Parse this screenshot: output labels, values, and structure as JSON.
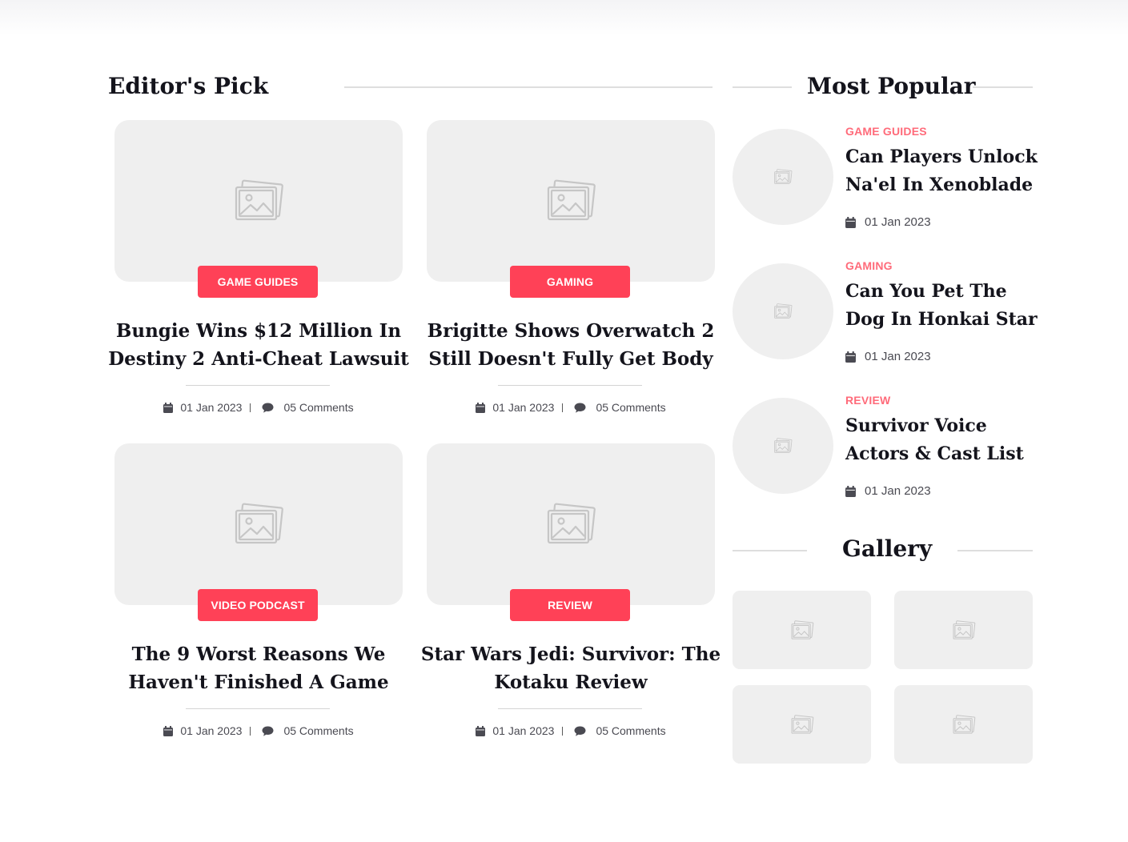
{
  "editors_pick": {
    "heading": "Editor's Pick",
    "cards": [
      {
        "category": "GAME GUIDES",
        "title": "Bungie Wins $12 Million In Destiny 2 Anti-Cheat Lawsuit",
        "date": "01 Jan 2023",
        "comments": "05 Comments"
      },
      {
        "category": "GAMING",
        "title": "Brigitte Shows Overwatch 2 Still Doesn't Fully Get Body",
        "date": "01 Jan 2023",
        "comments": "05 Comments"
      },
      {
        "category": "VIDEO PODCAST",
        "title": "The 9 Worst Reasons We Haven't Finished A Game",
        "date": "01 Jan 2023",
        "comments": "05 Comments"
      },
      {
        "category": "REVIEW",
        "title": "Star Wars Jedi: Survivor: The Kotaku Review",
        "date": "01 Jan 2023",
        "comments": "05 Comments"
      }
    ]
  },
  "most_popular": {
    "heading": "Most Popular",
    "items": [
      {
        "category": "GAME GUIDES",
        "title": "Can Players Unlock Na'el In Xenoblade",
        "date": "01 Jan 2023"
      },
      {
        "category": "GAMING",
        "title": "Can You Pet The Dog In Honkai Star",
        "date": "01 Jan 2023"
      },
      {
        "category": "REVIEW",
        "title": "Survivor Voice Actors & Cast List",
        "date": "01 Jan 2023"
      }
    ]
  },
  "gallery": {
    "heading": "Gallery"
  },
  "icons": {
    "placeholder": "image-placeholder-icon",
    "date": "calendar-icon",
    "comments": "comment-icon"
  },
  "colors": {
    "accent": "#ff4157",
    "category_text": "#ff6b7a",
    "placeholder_bg": "#efefef",
    "heading_text": "#14141c"
  }
}
